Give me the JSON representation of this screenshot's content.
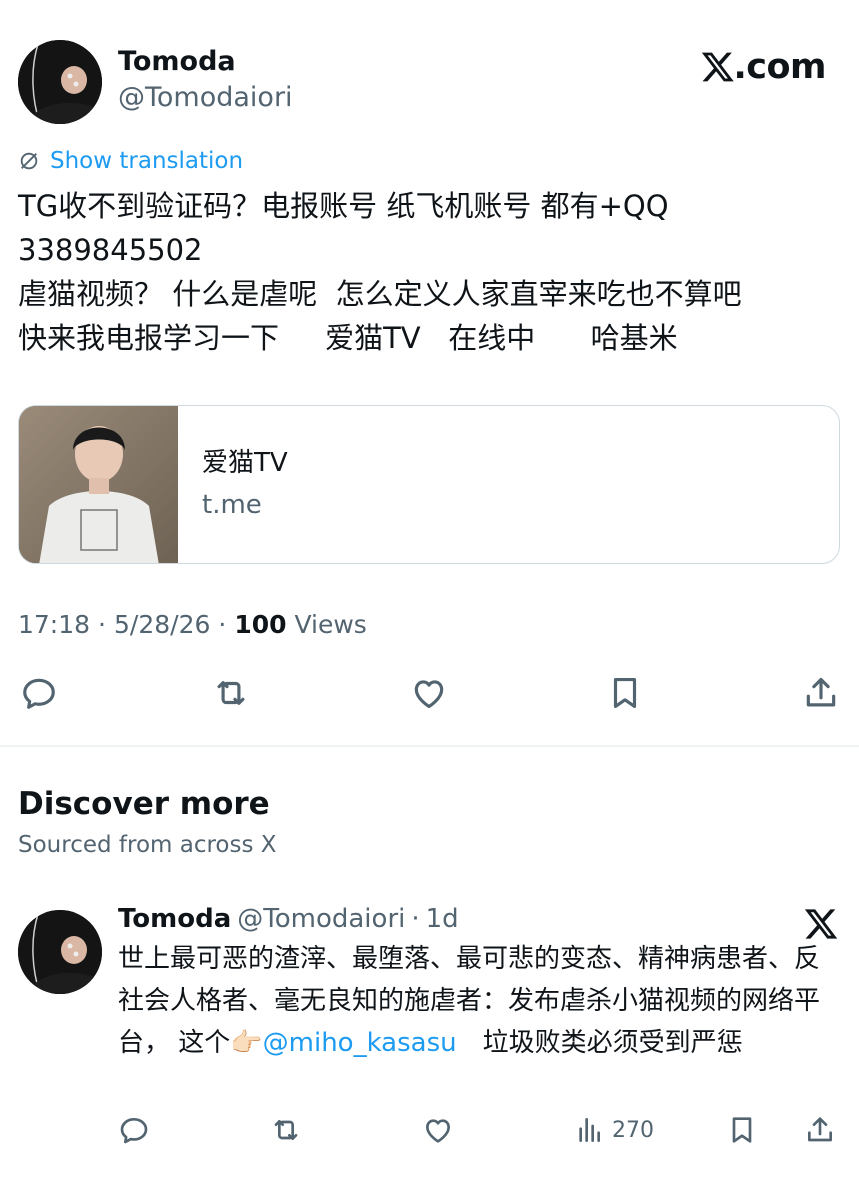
{
  "tweet": {
    "author_name": "Tomoda",
    "author_handle": "@Tomodaiori",
    "brand": ".com",
    "translate_label": "Show translation",
    "text": "TG收不到验证码？电报账号 纸飞机账号 都有+QQ\n3389845502\n虐猫视频？ 什么是虐呢  怎么定义人家直宰来吃也不算吧\n快来我电报学习一下     爱猫TV   在线中      哈基米",
    "card": {
      "title": "爱猫TV",
      "domain": "t.me"
    },
    "time": "17:18",
    "dot1": "·",
    "date": "5/28/26",
    "dot2": "·",
    "views_count": "100",
    "views_label": "Views",
    "icons": [
      "reply-icon",
      "retweet-icon",
      "like-icon",
      "bookmark-icon",
      "share-icon"
    ]
  },
  "discover": {
    "title": "Discover more",
    "subtitle": "Sourced from across X"
  },
  "related": {
    "author_name": "Tomoda",
    "author_handle": "@Tomodaiori",
    "dot": "·",
    "age": "1d",
    "text_before": "世上最可恶的渣滓、最堕落、最可悲的变态、精神病患者、反社会人格者、毫无良知的施虐者：发布虐杀小猫视频的网络平台， 这个",
    "emoji": "👉🏻",
    "mention": "@miho_kasasu",
    "text_after": "　垃圾败类必须受到严惩",
    "views": "270",
    "icons": [
      "reply-icon",
      "retweet-icon",
      "like-icon",
      "views-chart-icon",
      "bookmark-icon",
      "share-icon"
    ]
  }
}
